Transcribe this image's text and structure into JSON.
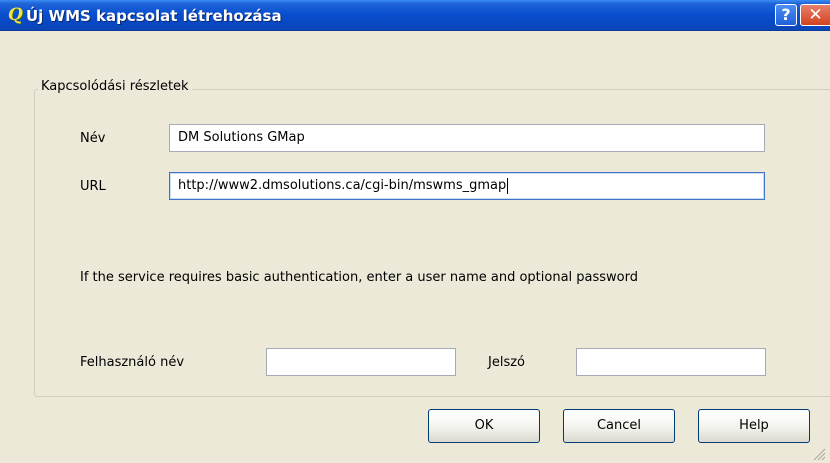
{
  "window": {
    "title": "Új WMS kapcsolat létrehozása",
    "app_icon": "Q",
    "help_glyph": "?",
    "close_glyph": "✕"
  },
  "group": {
    "title": "Kapcsolódási részletek"
  },
  "fields": {
    "name_label": "Név",
    "name_value": "DM Solutions GMap",
    "url_label": "URL",
    "url_value": "http://www2.dmsolutions.ca/cgi-bin/mswms_gmap",
    "auth_hint": "If the service requires basic authentication, enter a user name and optional password",
    "username_label": "Felhasználó név",
    "username_value": "",
    "password_label": "Jelszó",
    "password_value": ""
  },
  "buttons": {
    "ok": "OK",
    "cancel": "Cancel",
    "help": "Help"
  }
}
